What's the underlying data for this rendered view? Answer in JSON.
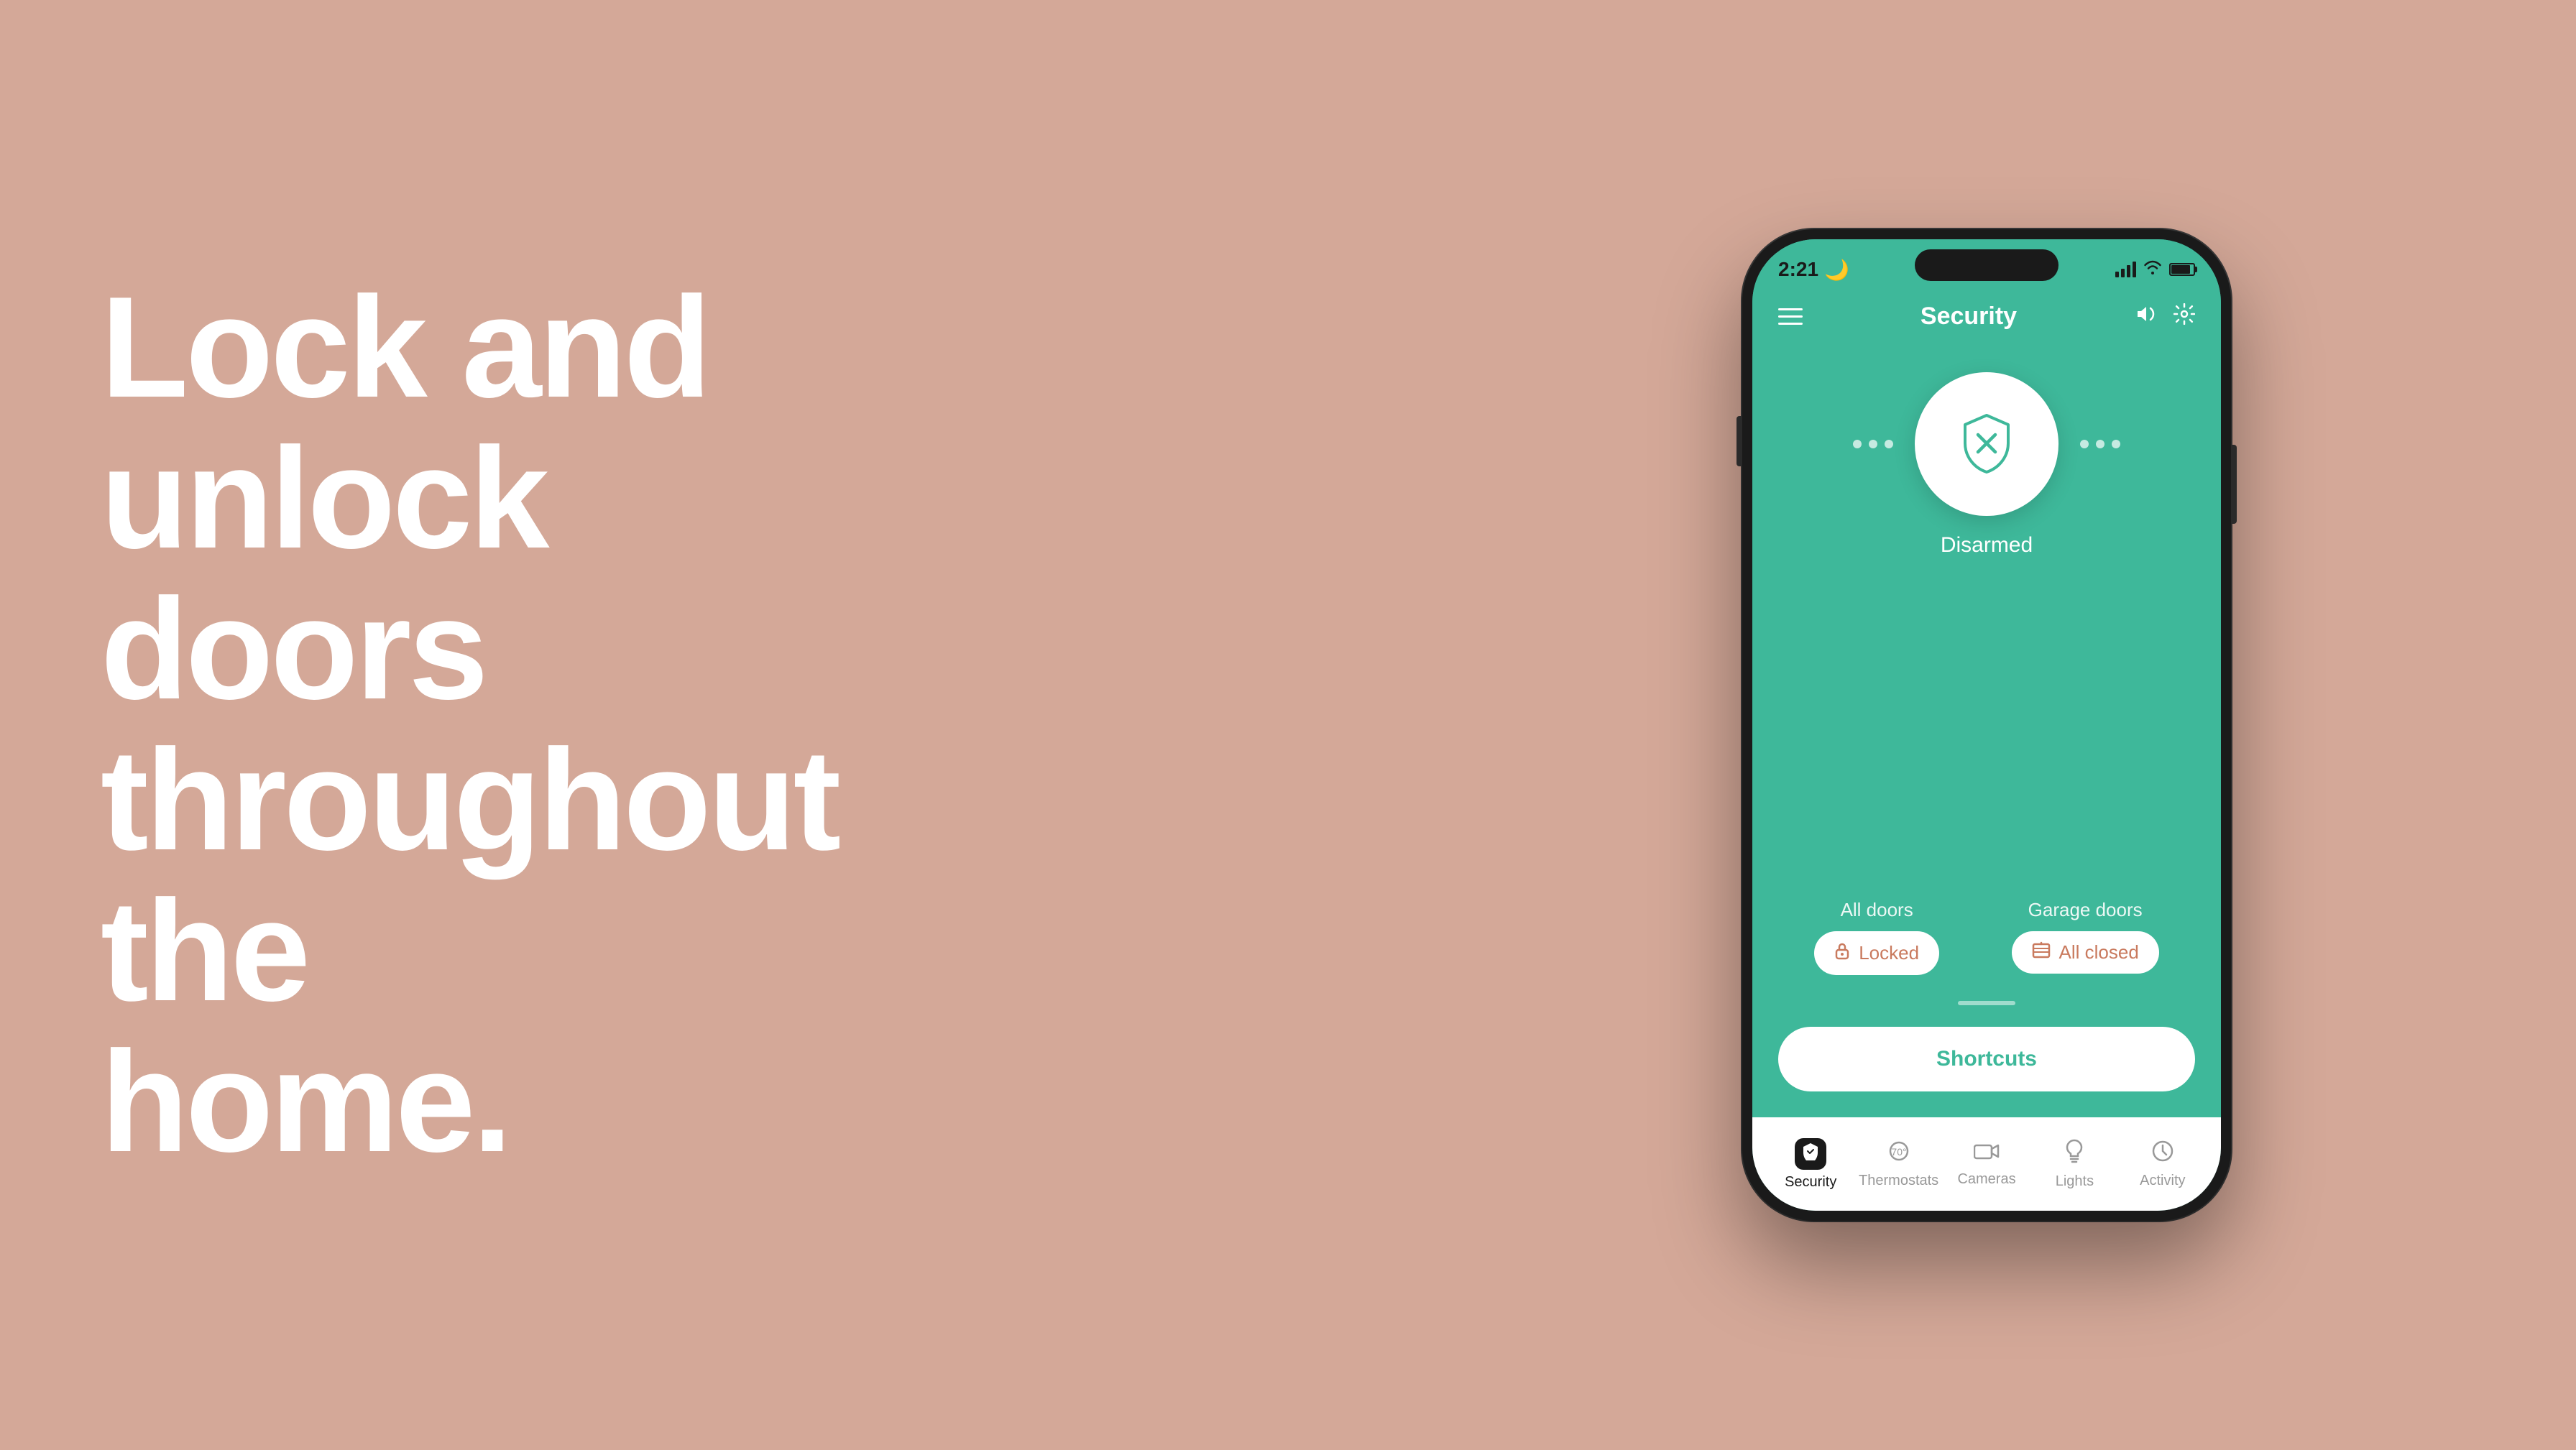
{
  "background": {
    "color": "#d4a898"
  },
  "hero": {
    "line1": "Lock and",
    "line2": "unlock",
    "line3": "doors",
    "line4": "throughout",
    "line5": "the home."
  },
  "phone": {
    "status_bar": {
      "time": "2:21",
      "moon": "🌙",
      "battery_percent": "94"
    },
    "header": {
      "title": "Security",
      "hamburger_aria": "menu",
      "sound_icon": "🔈",
      "settings_icon": "⚙️"
    },
    "security": {
      "status": "Disarmed"
    },
    "doors": {
      "all_doors": {
        "label": "All doors",
        "badge": "Locked"
      },
      "garage_doors": {
        "label": "Garage doors",
        "badge": "All closed"
      }
    },
    "shortcuts": {
      "label": "Shortcuts"
    },
    "nav": {
      "items": [
        {
          "id": "security",
          "label": "Security",
          "active": true
        },
        {
          "id": "thermostats",
          "label": "Thermostats",
          "active": false
        },
        {
          "id": "cameras",
          "label": "Cameras",
          "active": false
        },
        {
          "id": "lights",
          "label": "Lights",
          "active": false
        },
        {
          "id": "activity",
          "label": "Activity",
          "active": false
        }
      ]
    }
  },
  "colors": {
    "app_green": "#3eb89a",
    "badge_orange": "#c97a5e",
    "background_pink": "#d4a898"
  }
}
